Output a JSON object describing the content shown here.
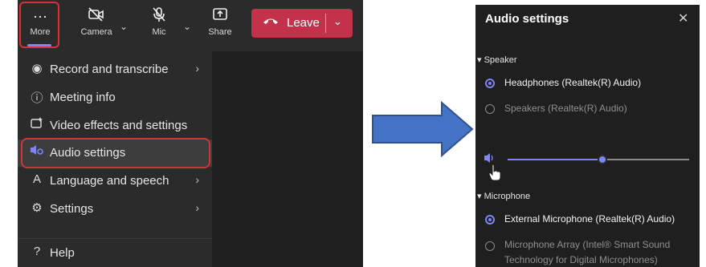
{
  "toolbar": {
    "more_label": "More",
    "camera_label": "Camera",
    "mic_label": "Mic",
    "share_label": "Share",
    "leave_label": "Leave"
  },
  "menu": {
    "items": [
      {
        "label": "Record and transcribe",
        "icon": "record-icon",
        "has_submenu": true
      },
      {
        "label": "Meeting info",
        "icon": "info-icon",
        "has_submenu": false
      },
      {
        "label": "Video effects and settings",
        "icon": "video-effects-icon",
        "has_submenu": false
      },
      {
        "label": "Audio settings",
        "icon": "speaker-settings-icon",
        "has_submenu": false,
        "selected": true
      },
      {
        "label": "Language and speech",
        "icon": "language-icon",
        "has_submenu": true
      },
      {
        "label": "Settings",
        "icon": "gear-icon",
        "has_submenu": true
      },
      {
        "label": "Help",
        "icon": "help-icon",
        "has_submenu": false
      }
    ]
  },
  "audio_settings": {
    "title": "Audio settings",
    "speaker_section": "Speaker",
    "speaker_options": [
      {
        "label": "Headphones (Realtek(R) Audio)",
        "selected": true
      },
      {
        "label": "Speakers (Realtek(R) Audio)",
        "selected": false
      }
    ],
    "speaker_volume": 0.52,
    "microphone_section": "Microphone",
    "microphone_options": [
      {
        "label": "External Microphone (Realtek(R) Audio)",
        "selected": true
      },
      {
        "label_line1": "Microphone Array (Intel® Smart Sound",
        "label_line2": "Technology for Digital Microphones)",
        "selected": false
      }
    ]
  },
  "colors": {
    "accent": "#7f85f5",
    "highlight": "#d13438",
    "leave_button": "#c4314b",
    "arrow": "#4472c4"
  }
}
